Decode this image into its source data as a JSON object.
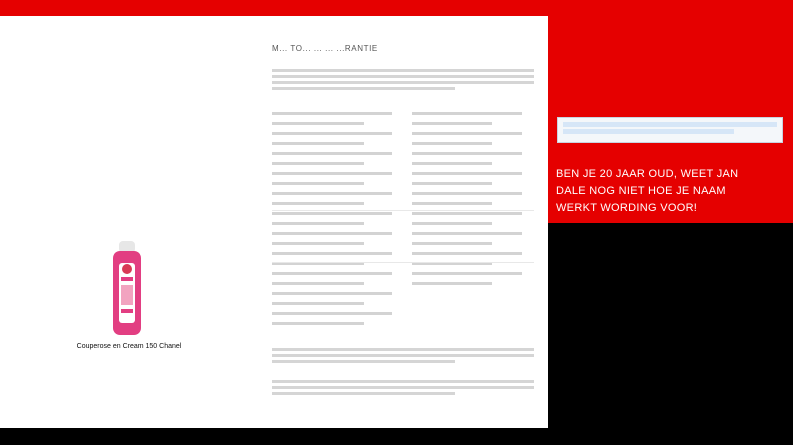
{
  "product": {
    "caption": "Couperose en Cream 150 Chanel",
    "image_colors": {
      "body": "#e23e82",
      "cap": "#cfcfcf",
      "label": "#ffffff"
    }
  },
  "article": {
    "heading": "M... TO... ... ... ...RANTIE"
  },
  "sidebar": {
    "notice_text": "",
    "promo_text": "BEN JE 20 JAAR OUD, WEET JAN DALE NOG NIET HOE JE NAAM WERKT WORDING VOOR!"
  },
  "colors": {
    "brand_red": "#e50000",
    "black": "#000000",
    "panel": "#ffffff"
  }
}
